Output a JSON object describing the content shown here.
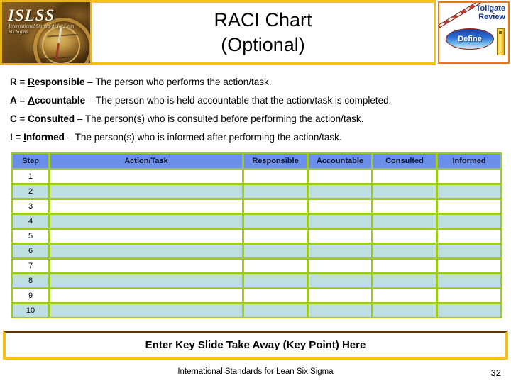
{
  "header": {
    "logo": {
      "brand": "ISLSS",
      "subtitle": "International Standards for Lean Six Sigma"
    },
    "title_line1": "RACI Chart",
    "title_line2": "(Optional)",
    "tollgate": {
      "label_line1": "Tollgate",
      "label_line2": "Review",
      "phase_label": "Define"
    }
  },
  "definitions": [
    {
      "letter": "R",
      "eq": " = ",
      "first": "R",
      "rest": "esponsible",
      "description": " – The person who performs the action/task."
    },
    {
      "letter": "A",
      "eq": " = ",
      "first": "A",
      "rest": "ccountable",
      "description": " – The person who is held accountable that the action/task is completed."
    },
    {
      "letter": "C",
      "eq": " = ",
      "first": "C",
      "rest": "onsulted",
      "description": " – The person(s) who is consulted before performing the action/task."
    },
    {
      "letter": "I",
      "eq": " = ",
      "first": "I",
      "rest": "nformed",
      "description": " – The person(s) who is informed after performing the action/task."
    }
  ],
  "table": {
    "columns": [
      "Step",
      "Action/Task",
      "Responsible",
      "Accountable",
      "Consulted",
      "Informed"
    ],
    "rows": [
      {
        "step": "1",
        "task": "",
        "responsible": "",
        "accountable": "",
        "consulted": "",
        "informed": ""
      },
      {
        "step": "2",
        "task": "",
        "responsible": "",
        "accountable": "",
        "consulted": "",
        "informed": ""
      },
      {
        "step": "3",
        "task": "",
        "responsible": "",
        "accountable": "",
        "consulted": "",
        "informed": ""
      },
      {
        "step": "4",
        "task": "",
        "responsible": "",
        "accountable": "",
        "consulted": "",
        "informed": ""
      },
      {
        "step": "5",
        "task": "",
        "responsible": "",
        "accountable": "",
        "consulted": "",
        "informed": ""
      },
      {
        "step": "6",
        "task": "",
        "responsible": "",
        "accountable": "",
        "consulted": "",
        "informed": ""
      },
      {
        "step": "7",
        "task": "",
        "responsible": "",
        "accountable": "",
        "consulted": "",
        "informed": ""
      },
      {
        "step": "8",
        "task": "",
        "responsible": "",
        "accountable": "",
        "consulted": "",
        "informed": ""
      },
      {
        "step": "9",
        "task": "",
        "responsible": "",
        "accountable": "",
        "consulted": "",
        "informed": ""
      },
      {
        "step": "10",
        "task": "",
        "responsible": "",
        "accountable": "",
        "consulted": "",
        "informed": ""
      }
    ]
  },
  "key_takeaway": "Enter Key Slide Take Away (Key Point) Here",
  "footer": {
    "text": "International Standards for Lean Six Sigma",
    "page_number": "32"
  },
  "colors": {
    "accent_yellow": "#F2C216",
    "table_border_green": "#9FCB1E",
    "header_blue": "#6B8FE8",
    "row_tint": "#BFDEE2",
    "tollgate_border": "#E8761A",
    "tollgate_text": "#1A3A8F"
  }
}
